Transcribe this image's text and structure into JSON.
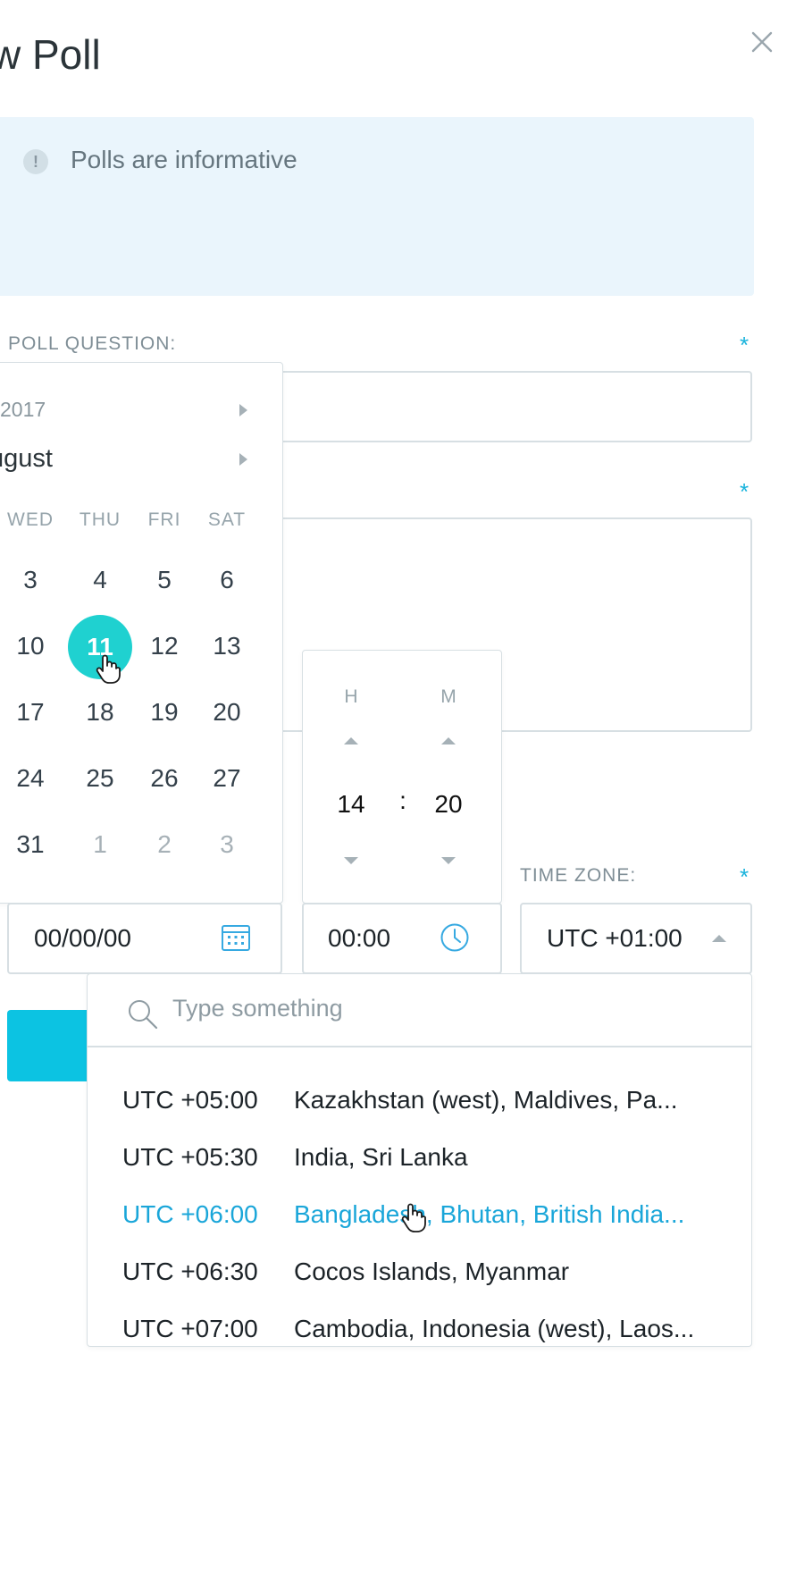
{
  "header": {
    "title": "w Poll",
    "close_label": "×"
  },
  "alert": {
    "icon_glyph": "!",
    "text": "Polls are informative"
  },
  "form": {
    "poll_question_label": "POLL QUESTION:",
    "required_mark": "*",
    "time_zone_label": "TIME ZONE:",
    "date_value": "00/00/00",
    "time_value": "00:00",
    "time_zone_value": "UTC +01:00"
  },
  "calendar": {
    "year": "2017",
    "month": "ugust",
    "weekdays": [
      "WED",
      "THU",
      "FRI",
      "SAT"
    ],
    "weeks": [
      [
        "3",
        "4",
        "5",
        "6"
      ],
      [
        "10",
        "11",
        "12",
        "13"
      ],
      [
        "17",
        "18",
        "19",
        "20"
      ],
      [
        "24",
        "25",
        "26",
        "27"
      ],
      [
        "31",
        "1",
        "2",
        "3"
      ]
    ],
    "selected_day": "11",
    "accent_color": "#1fd1d0"
  },
  "time_picker": {
    "hour_label": "H",
    "minute_label": "M",
    "separator": ":",
    "hour": "14",
    "minute": "20"
  },
  "time_zone_dropdown": {
    "search_placeholder": "Type something",
    "options": [
      {
        "offset": "UTC +05:00",
        "name": "Kazakhstan (west), Maldives, Pa..."
      },
      {
        "offset": "UTC +05:30",
        "name": "India, Sri Lanka"
      },
      {
        "offset": "UTC +06:00",
        "name": "Bangladesh, Bhutan, British India..."
      },
      {
        "offset": "UTC +06:30",
        "name": "Cocos Islands, Myanmar"
      },
      {
        "offset": "UTC +07:00",
        "name": "Cambodia, Indonesia (west), Laos..."
      }
    ],
    "highlighted_index": 2,
    "highlight_color": "#1aa6d9"
  },
  "colors": {
    "primary_button": "#0cc3e2",
    "alert_bg": "#eaf5fc",
    "icon_accent": "#19b3dc"
  }
}
